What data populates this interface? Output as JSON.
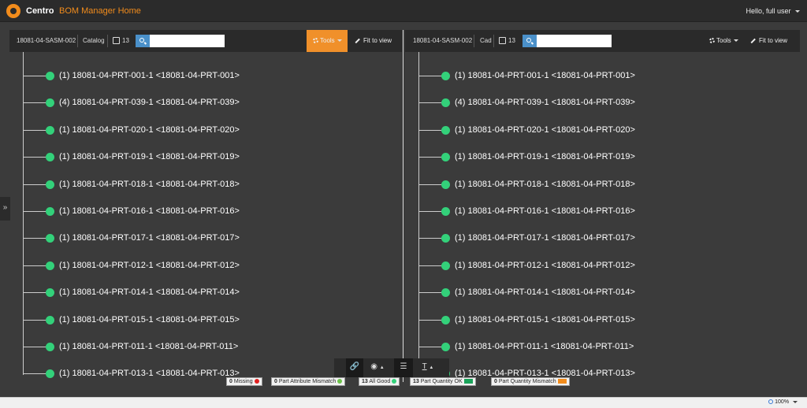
{
  "app": {
    "brand": "Centro",
    "title": "BOM Manager Home",
    "user_greeting": "Hello, full user"
  },
  "left_pane": {
    "assembly": "18081-04-SASM-002",
    "source": "Catalog",
    "count": "13",
    "search_placeholder": "",
    "tools_label": "Tools",
    "fit_label": "Fit to view"
  },
  "right_pane": {
    "assembly": "18081-04-SASM-002",
    "source": "Cad",
    "count": "13",
    "search_placeholder": "",
    "tools_label": "Tools",
    "fit_label": "Fit to view"
  },
  "tree_nodes": [
    "(1) 18081-04-PRT-001-1 <18081-04-PRT-001>",
    "(4) 18081-04-PRT-039-1 <18081-04-PRT-039>",
    "(1) 18081-04-PRT-020-1 <18081-04-PRT-020>",
    "(1) 18081-04-PRT-019-1 <18081-04-PRT-019>",
    "(1) 18081-04-PRT-018-1 <18081-04-PRT-018>",
    "(1) 18081-04-PRT-016-1 <18081-04-PRT-016>",
    "(1) 18081-04-PRT-017-1 <18081-04-PRT-017>",
    "(1) 18081-04-PRT-012-1 <18081-04-PRT-012>",
    "(1) 18081-04-PRT-014-1 <18081-04-PRT-014>",
    "(1) 18081-04-PRT-015-1 <18081-04-PRT-015>",
    "(1) 18081-04-PRT-011-1 <18081-04-PRT-011>",
    "(1) 18081-04-PRT-013-1 <18081-04-PRT-013>"
  ],
  "legend": [
    {
      "count": "0",
      "label": "Missing",
      "color": "#e02020",
      "marker": "dot"
    },
    {
      "count": "0",
      "label": "Part Attribute Mismatch",
      "color": "#6cc24a",
      "marker": "dot"
    },
    {
      "count": "13",
      "label": "All Good",
      "color": "#33d17a",
      "marker": "dot"
    },
    {
      "count": "13",
      "label": "Part Quantity OK",
      "color": "#1aa35a",
      "marker": "box"
    },
    {
      "count": "0",
      "label": "Part Quantity Mismatch",
      "color": "#f28c1c",
      "marker": "box"
    }
  ],
  "status": {
    "zoom": "100%"
  },
  "colors": {
    "accent": "#f28c1c",
    "node": "#33d17a",
    "search": "#4a90c9"
  }
}
